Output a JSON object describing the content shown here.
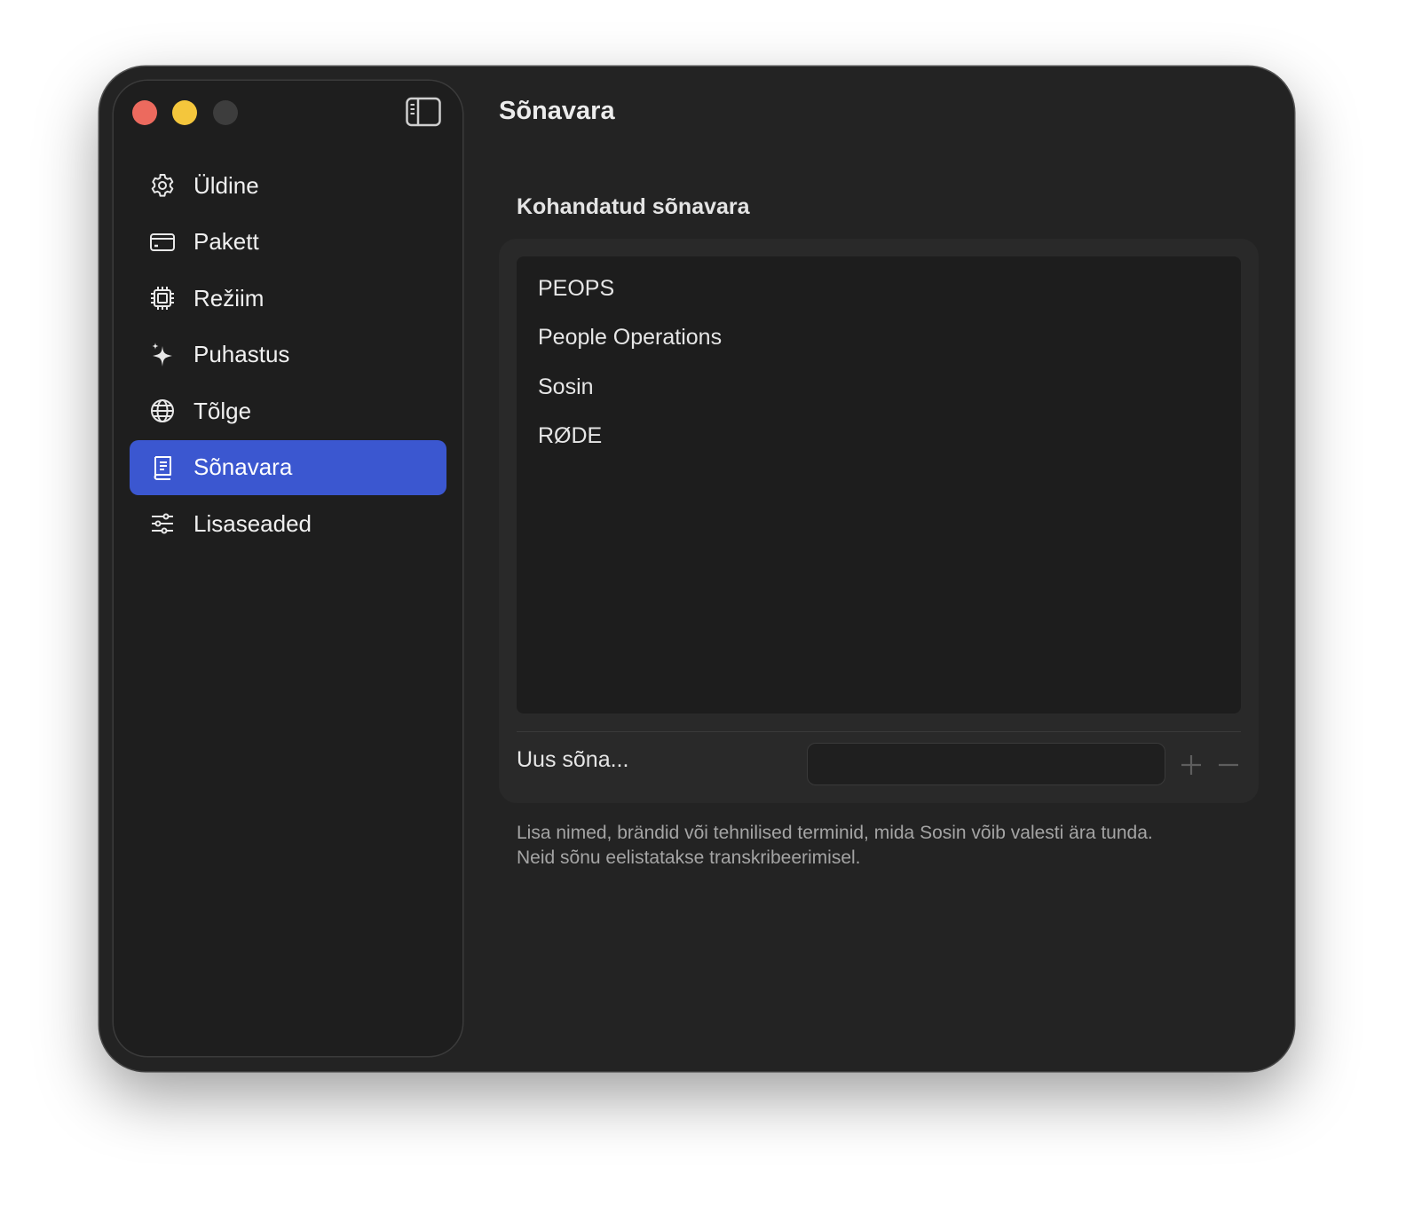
{
  "header": {
    "title": "Sõnavara"
  },
  "sidebar": {
    "items": [
      {
        "label": "Üldine",
        "icon": "gear-icon",
        "active": false
      },
      {
        "label": "Pakett",
        "icon": "credit-card-icon",
        "active": false
      },
      {
        "label": "Režiim",
        "icon": "cpu-chip-icon",
        "active": false
      },
      {
        "label": "Puhastus",
        "icon": "sparkles-icon",
        "active": false
      },
      {
        "label": "Tõlge",
        "icon": "globe-icon",
        "active": false
      },
      {
        "label": "Sõnavara",
        "icon": "book-icon",
        "active": true
      },
      {
        "label": "Lisaseaded",
        "icon": "sliders-icon",
        "active": false
      }
    ]
  },
  "vocabulary": {
    "section_title": "Kohandatud sõnavara",
    "words": [
      "PEOPS",
      "People Operations",
      "Sosin",
      "RØDE"
    ],
    "new_word_label": "Uus sõna...",
    "new_word_value": "",
    "help_line1": "Lisa nimed, brändid või tehnilised terminid, mida Sosin võib valesti ära tunda.",
    "help_line2": "Neid sõnu eelistatakse transkribeerimisel."
  },
  "colors": {
    "accent": "#3b57d0",
    "window_bg": "#232323",
    "sidebar_bg": "#1e1e1e",
    "close": "#ec6a5e",
    "minimize": "#f4c63c",
    "zoom_inactive": "#3d3d3d"
  }
}
